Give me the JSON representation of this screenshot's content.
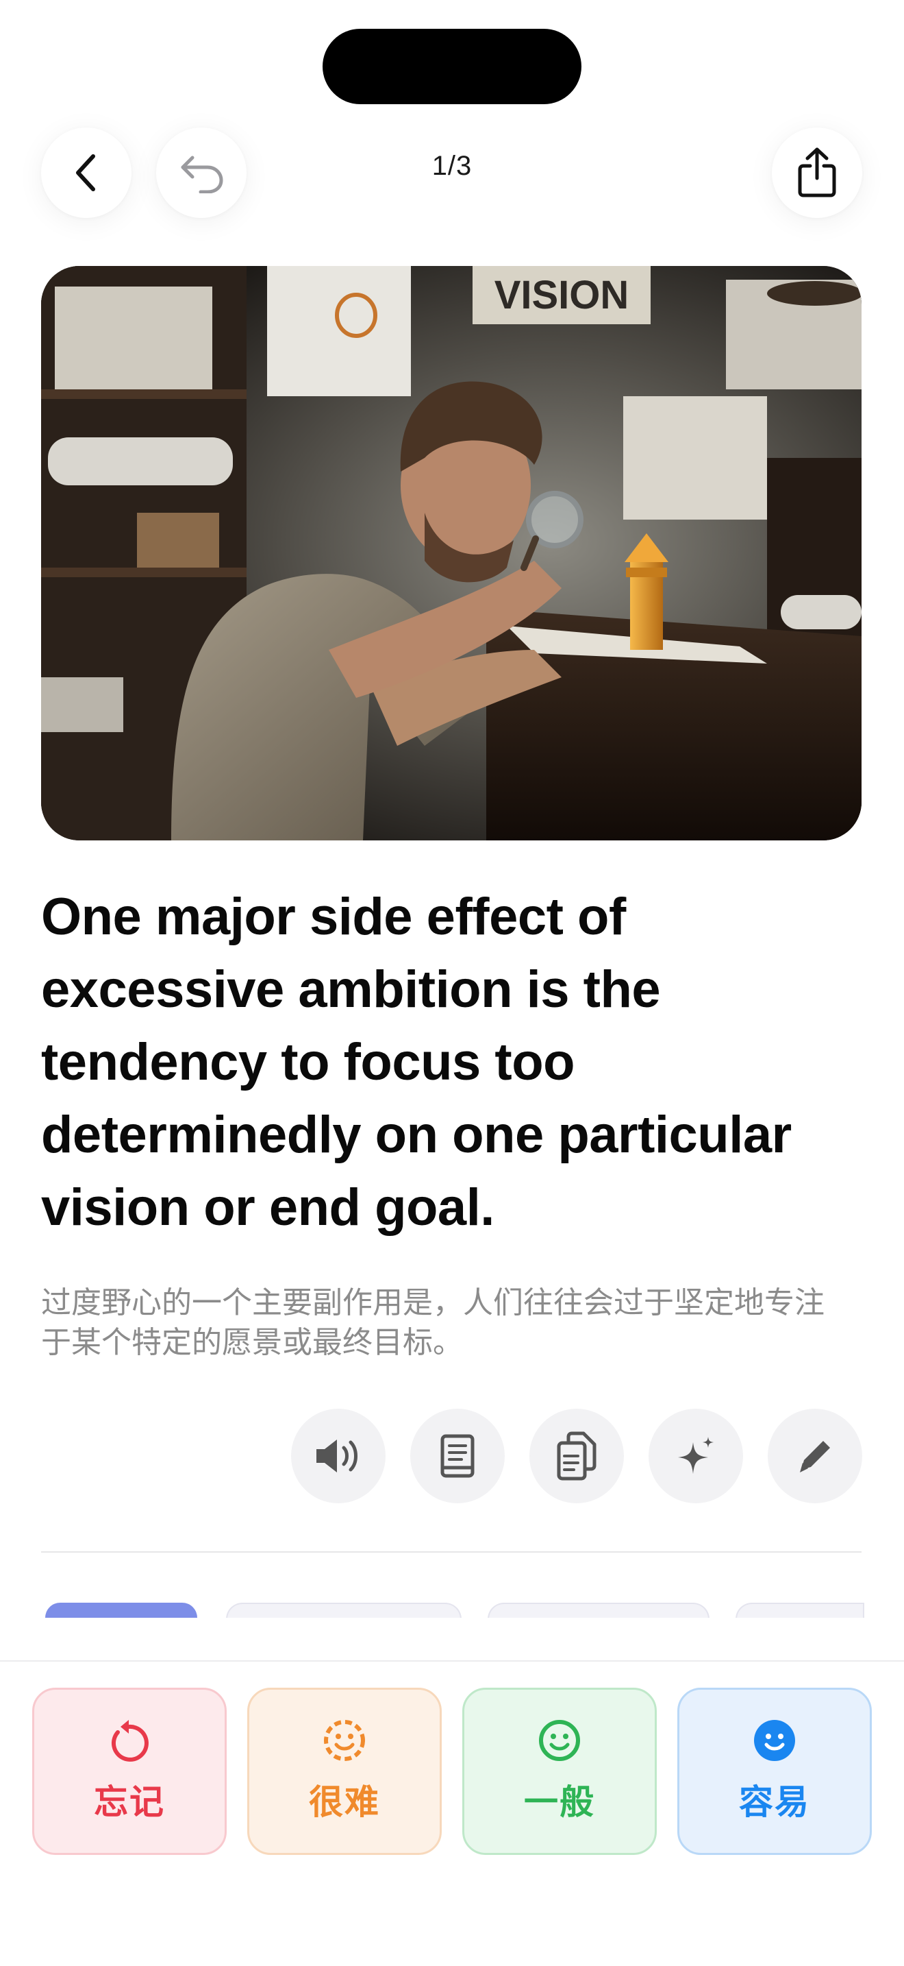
{
  "header": {
    "counter": "1/3",
    "back_icon": "chevron-left-icon",
    "undo_icon": "undo-icon",
    "share_icon": "share-icon"
  },
  "card": {
    "image_icon": "illustration",
    "sentence": "One major side effect of excessive ambition is the tendency to focus too determinedly on one particular vision or end goal.",
    "translation": "过度野心的一个主要副作用是，人们往往会过于坚定地专注于某个特定的愿景或最终目标。",
    "poster_text": "VISION"
  },
  "actions": [
    {
      "icon": "speaker-icon"
    },
    {
      "icon": "book-icon"
    },
    {
      "icon": "copy-icon"
    },
    {
      "icon": "sparkle-icon"
    },
    {
      "icon": "pencil-icon"
    }
  ],
  "grades": [
    {
      "label": "忘记",
      "icon": "restart-icon",
      "color": "#e8394a",
      "bg": "#fdeaec",
      "border": "#f8c9ce"
    },
    {
      "label": "很难",
      "icon": "dashed-smile-icon",
      "color": "#f08a2c",
      "bg": "#fdf1e6",
      "border": "#f7d8bb"
    },
    {
      "label": "一般",
      "icon": "smile-icon",
      "color": "#2eb455",
      "bg": "#e8f8ec",
      "border": "#bfe8c9"
    },
    {
      "label": "容易",
      "icon": "smile-filled-icon",
      "color": "#1a86f0",
      "bg": "#e7f1fd",
      "border": "#b9d8f7"
    }
  ]
}
